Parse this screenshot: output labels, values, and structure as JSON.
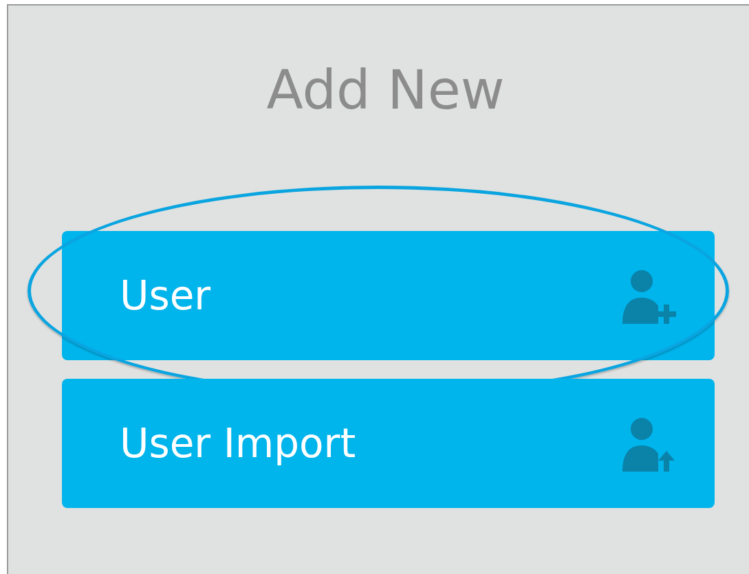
{
  "panel": {
    "title": "Add New",
    "items": [
      {
        "label": "User",
        "kind": "add",
        "highlighted": true
      },
      {
        "label": "User Import",
        "kind": "import",
        "highlighted": false
      }
    ]
  }
}
